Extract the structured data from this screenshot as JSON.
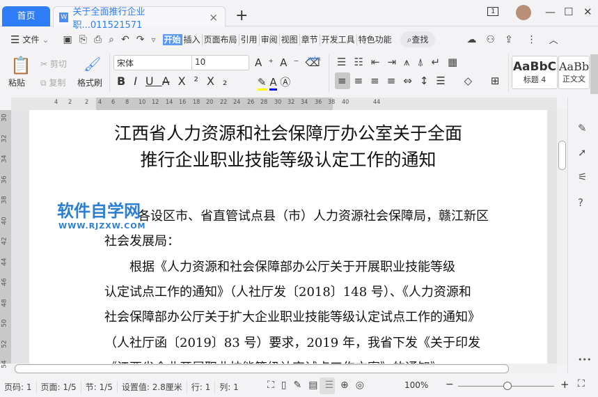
{
  "tabs": {
    "home": "首页",
    "doc_icon": "W",
    "doc": "关于全面推行企业职...011521571",
    "close": "×",
    "new": "+"
  },
  "window": {
    "badge": "1",
    "min": "—",
    "max": "☐",
    "close": "✕"
  },
  "menu": {
    "file": "文件",
    "tabs": [
      "开始",
      "插入",
      "页面布局",
      "引用",
      "审阅",
      "视图",
      "章节",
      "开发工具",
      "特色功能"
    ],
    "search": "查找"
  },
  "ribbon": {
    "paste": "粘贴",
    "cut": "剪切",
    "copy": "复制",
    "format_painter": "格式刷",
    "font": "宋体",
    "size": "10",
    "styles": [
      {
        "sample": "AaBbC",
        "name": "标题 4"
      },
      {
        "sample": "AaBb",
        "name": "正文文"
      }
    ],
    "pinyin": "wén"
  },
  "ruler": {
    "h": [
      "4",
      "2",
      "2",
      "4",
      "6",
      "8",
      "10",
      "12",
      "14",
      "16",
      "18",
      "20",
      "22",
      "24",
      "26",
      "28",
      "30",
      "32",
      "34",
      "36",
      "38",
      "40",
      "44"
    ],
    "v": [
      "30",
      "32",
      "34",
      "36",
      "38",
      "40",
      "42",
      "44",
      "46",
      "48",
      "50",
      "52",
      "54"
    ]
  },
  "document": {
    "title": [
      "江西省人力资源和社会保障厅办公室关于全面",
      "推行企业职业技能等级认定工作的通知"
    ],
    "lines": [
      "各设区市、省直管试点县（市）人力资源社会保障局，赣江新区",
      "社会发展局：",
      "　　根据《人力资源和社会保障部办公厅关于开展职业技能等级",
      "认定试点工作的通知》（人社厅发〔2018〕148 号）、《人力资源和",
      "社会保障部办公厅关于扩大企业职业技能等级认定试点工作的通知》",
      "（人社厅函〔2019〕83 号）要求，2019 年，我省下发《关于印发",
      "《江西省企业开展职业技能等级认定试点工作方案》的通知》"
    ]
  },
  "watermark": {
    "text": "软件自学网",
    "url": "WWW.RJZXW.COM"
  },
  "status": {
    "page": "页码: 1",
    "pages": "页面: 1/5",
    "section": "节: 1/5",
    "setting": "设置值: 2.8厘米",
    "row": "行: 1",
    "col": "列: 1",
    "zoom": "100%",
    "zoom_value": 100
  },
  "colors": {
    "accent": "#2f7df6"
  }
}
